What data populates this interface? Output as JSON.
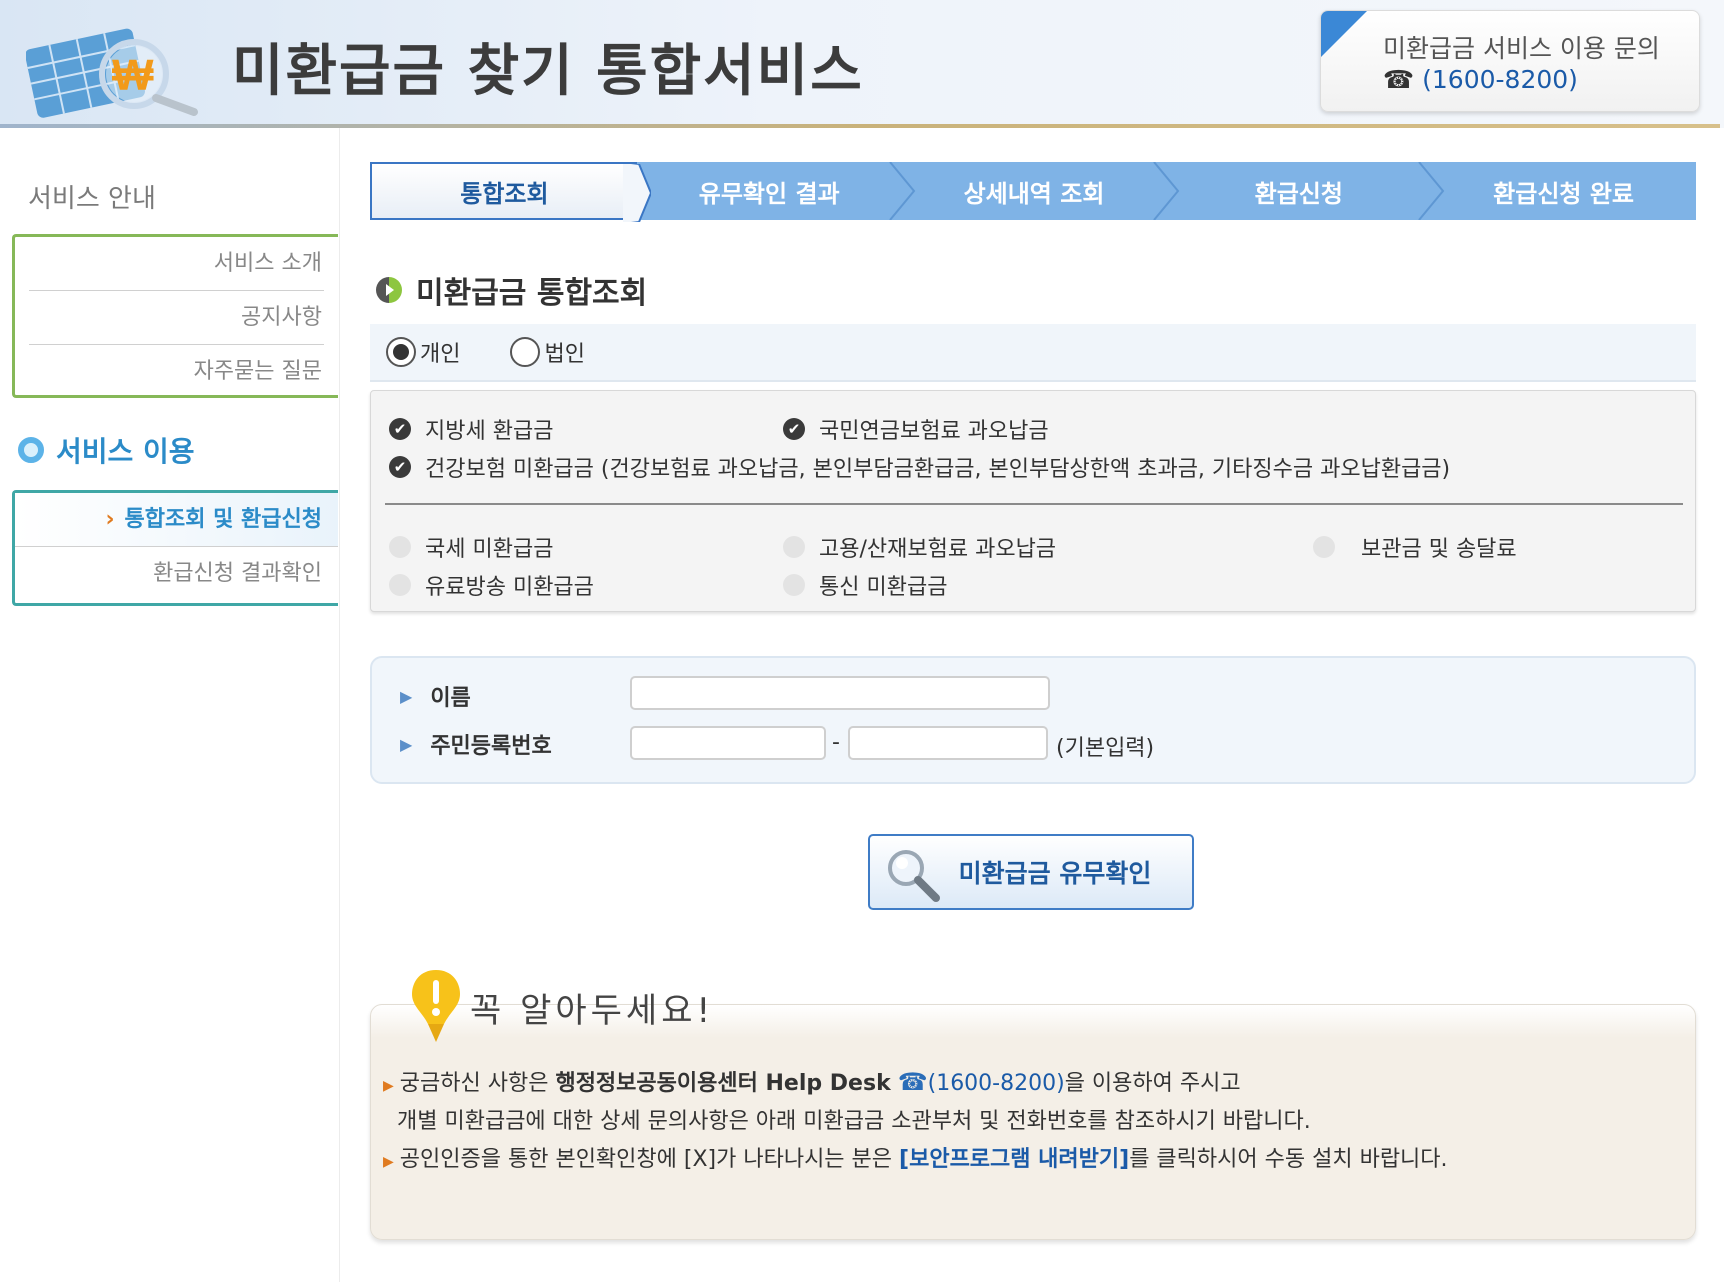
{
  "header": {
    "site_title": "미환급금 찾기 통합서비스",
    "inquiry_title": "미환급금 서비스 이용 문의",
    "inquiry_phone": "(1600-8200)",
    "phone_icon": "☎"
  },
  "sidebar": {
    "heading": "서비스 안내",
    "guide_items": [
      {
        "label": "서비스 소개"
      },
      {
        "label": "공지사항"
      },
      {
        "label": "자주묻는 질문"
      }
    ],
    "service_use_title": "서비스 이용",
    "use_items": [
      {
        "label": "통합조회 및 환급신청",
        "active": true
      },
      {
        "label": "환급신청 결과확인",
        "active": false
      }
    ],
    "active_arrow": "›"
  },
  "steps": [
    {
      "label": "통합조회",
      "active": true
    },
    {
      "label": "유무확인 결과",
      "active": false
    },
    {
      "label": "상세내역 조회",
      "active": false
    },
    {
      "label": "환급신청",
      "active": false
    },
    {
      "label": "환급신청 완료",
      "active": false
    }
  ],
  "main": {
    "section_title": "미환급금 통합조회",
    "person_types": [
      {
        "label": "개인",
        "selected": true
      },
      {
        "label": "법인",
        "selected": false
      }
    ],
    "checked_items": [
      {
        "label": "지방세 환급금",
        "checked": true
      },
      {
        "label": "국민연금보험료 과오납금",
        "checked": true
      },
      {
        "label": "건강보험 미환급금 (건강보험료 과오납금, 본인부담금환급금, 본인부담상한액 초과금, 기타징수금 과오납환급금)",
        "checked": true
      }
    ],
    "unchecked_items": [
      {
        "label": "국세 미환급금",
        "checked": false
      },
      {
        "label": "고용/산재보험료 과오납금",
        "checked": false
      },
      {
        "label": "보관금 및 송달료",
        "checked": false
      },
      {
        "label": "유료방송 미환급금",
        "checked": false
      },
      {
        "label": "통신 미환급금",
        "checked": false
      }
    ],
    "form": {
      "name_label": "이름",
      "name_value": "",
      "rrn_label": "주민등록번호",
      "rrn_front": "",
      "rrn_back": "",
      "dash": "-",
      "hint": "(기본입력)"
    },
    "check_button": "미환급금 유무확인"
  },
  "notice": {
    "title": "꼭 알아두세요!",
    "line1_prefix": "궁금하신 사항은 ",
    "line1_bold": "행정정보공동이용센터 Help Desk",
    "line1_phone": "(1600-8200)",
    "line1_suffix": "을 이용하여 주시고",
    "line2": "개별 미환급금에 대한 상세 문의사항은 아래 미환급금 소관부처 및 전화번호를 참조하시기 바랍니다.",
    "line3_prefix": "공인인증을 통한 본인확인창에 [X]가 나타나시는 분은 ",
    "line3_link": "[보안프로그램 내려받기]",
    "line3_suffix": "를 클릭하시어 수동 설치 바랍니다."
  },
  "colors": {
    "step_inactive": "#7fb3e6",
    "accent_blue": "#2b8bc8",
    "sidebar_green": "#86b858",
    "sidebar_teal": "#3fa7a6",
    "orange": "#e07b20"
  },
  "icons": [
    "logo-illustration",
    "phone-icon",
    "section-bullet-icon",
    "magnifier-icon",
    "lightbulb-icon",
    "check-icon"
  ]
}
